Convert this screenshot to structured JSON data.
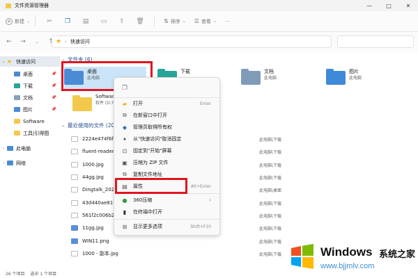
{
  "window": {
    "title": "文件资源管理器",
    "controls": [
      "—",
      "□",
      "✕"
    ]
  },
  "toolbar": {
    "new_label": "新建",
    "sort_label": "排序",
    "view_label": "查看",
    "more_label": "···"
  },
  "address": {
    "path": "快速访问"
  },
  "sidebar": {
    "items": [
      {
        "label": "快速访问",
        "icon": "star-icon",
        "color": "#f0b400"
      },
      {
        "label": "桌面",
        "icon": "desktop-icon",
        "color": "#4a8bd6",
        "pinned": true
      },
      {
        "label": "下载",
        "icon": "download-icon",
        "color": "#26a69a",
        "pinned": true
      },
      {
        "label": "文档",
        "icon": "document-icon",
        "color": "#8aa0b8",
        "pinned": true
      },
      {
        "label": "图片",
        "icon": "picture-icon",
        "color": "#4a8bd6",
        "pinned": true
      },
      {
        "label": "Software",
        "icon": "folder-icon",
        "color": "#f2c94c"
      },
      {
        "label": "工具|引得图",
        "icon": "folder-icon",
        "color": "#f2c94c"
      },
      {
        "label": "此电脑",
        "icon": "computer-icon",
        "color": "#4a8bd6"
      },
      {
        "label": "网络",
        "icon": "network-icon",
        "color": "#4a8bd6"
      }
    ]
  },
  "main": {
    "folders_header": "文件夹 (6)",
    "folders": [
      {
        "name": "桌面",
        "sub": "此电脑",
        "color": "#4a8bd6"
      },
      {
        "name": "下载",
        "sub": "",
        "color": "#26a69a"
      },
      {
        "name": "文档",
        "sub": "此电脑",
        "color": "#7f9bb8"
      },
      {
        "name": "图片",
        "sub": "此电脑",
        "color": "#3f8ad8"
      },
      {
        "name": "Software",
        "sub": "软件 (D:)\\...",
        "color": "#f2c94c"
      }
    ],
    "recent_header": "最近使用的文件 (20",
    "recent": [
      {
        "name": "2224e474f6fe...",
        "loc": "此电脑\\下载",
        "img": false
      },
      {
        "name": "fluent-reader...",
        "loc": "此电脑\\下载",
        "img": false
      },
      {
        "name": "1000.jpg",
        "loc": "此电脑\\下载",
        "img": false
      },
      {
        "name": "44gg.jpg",
        "loc": "此电脑\\下载",
        "img": false
      },
      {
        "name": "Dingtalk_2022...",
        "loc": "此电脑\\桌面",
        "img": false
      },
      {
        "name": "43d440ae819...",
        "loc": "此电脑\\下载",
        "img": false
      },
      {
        "name": "561f2c006b24...",
        "loc": "此电脑\\下载",
        "img": false
      },
      {
        "name": "11gg.jpg",
        "loc": "此电脑\\下载",
        "img": true
      },
      {
        "name": "WIN11.png",
        "loc": "此电脑\\下载",
        "img": true
      },
      {
        "name": "1000 - 副本.jpg",
        "loc": "此电脑\\下载",
        "img": false
      }
    ]
  },
  "context_menu": {
    "items": [
      {
        "label": "打开",
        "shortcut": "Enter",
        "icon": "open-icon"
      },
      {
        "label": "在新窗口中打开",
        "shortcut": "",
        "icon": "new-window-icon"
      },
      {
        "label": "管理员取得所有权",
        "shortcut": "",
        "icon": "admin-icon"
      },
      {
        "label": "从\"快速访问\"取消固定",
        "shortcut": "",
        "icon": "unpin-icon"
      },
      {
        "label": "固定到\"开始\"屏幕",
        "shortcut": "",
        "icon": "pin-start-icon"
      },
      {
        "label": "压缩为 ZIP 文件",
        "shortcut": "",
        "icon": "zip-icon"
      },
      {
        "label": "复制文件地址",
        "shortcut": "",
        "icon": "copy-path-icon"
      },
      {
        "label": "属性",
        "shortcut": "Alt+Enter",
        "icon": "properties-icon"
      },
      {
        "label": "360压缩",
        "shortcut": "",
        "icon": "360-icon",
        "submenu": true
      },
      {
        "label": "在终端中打开",
        "shortcut": "",
        "icon": "terminal-icon"
      },
      {
        "label": "显示更多选项",
        "shortcut": "Shift+F10",
        "icon": "more-options-icon"
      }
    ]
  },
  "status": {
    "count": "26 个项目",
    "selected": "选中 1 个项目"
  },
  "watermark": {
    "brand": "Windows",
    "brand_cn": "系统之家",
    "url": "www.bjjmlv.com"
  },
  "colors": {
    "highlight_box": "#e0141e",
    "selected_bg": "#e5eaf1"
  }
}
